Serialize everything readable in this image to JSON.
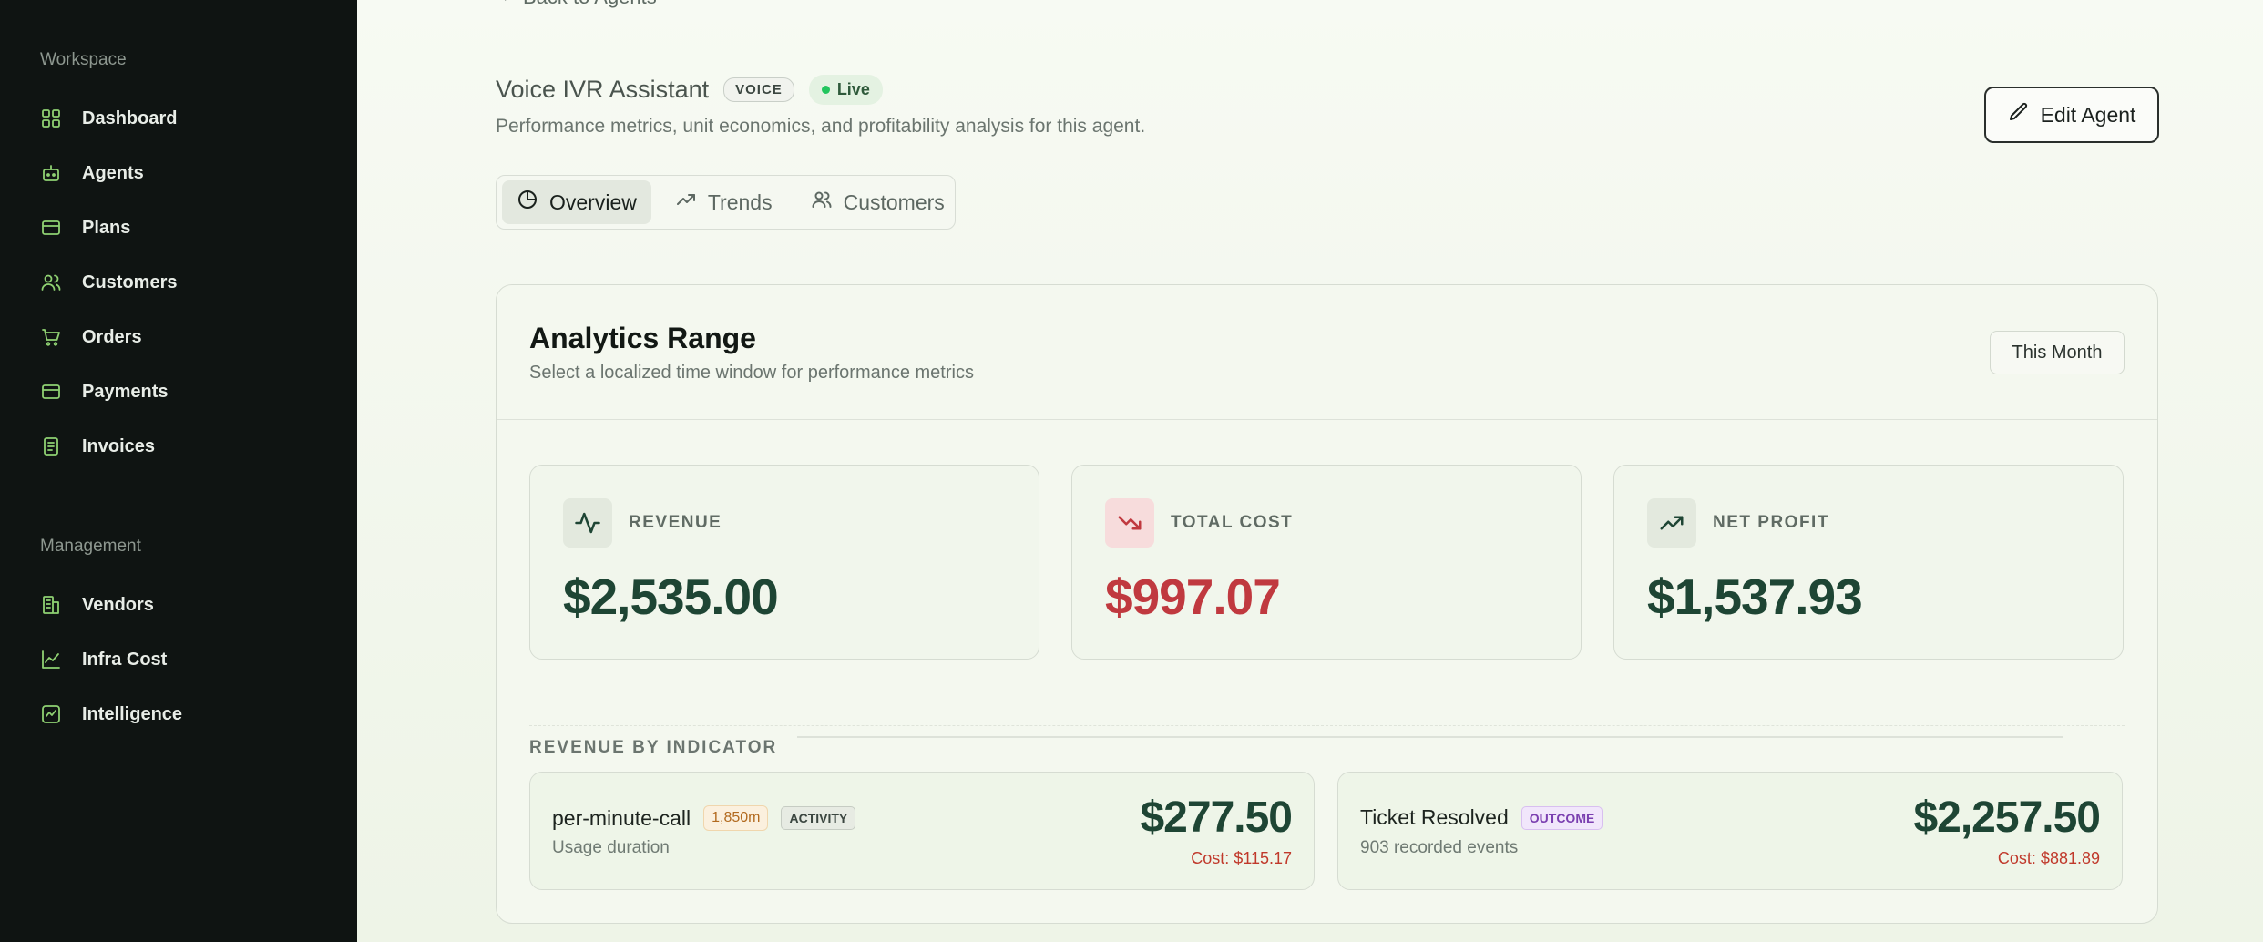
{
  "sidebar": {
    "workspace_label": "Workspace",
    "management_label": "Management",
    "workspace_items": [
      {
        "label": "Dashboard",
        "icon": "grid-icon"
      },
      {
        "label": "Agents",
        "icon": "bot-icon"
      },
      {
        "label": "Plans",
        "icon": "card-icon"
      },
      {
        "label": "Customers",
        "icon": "users-icon"
      },
      {
        "label": "Orders",
        "icon": "cart-icon"
      },
      {
        "label": "Payments",
        "icon": "card-icon"
      },
      {
        "label": "Invoices",
        "icon": "invoice-icon"
      }
    ],
    "management_items": [
      {
        "label": "Vendors",
        "icon": "building-icon"
      },
      {
        "label": "Infra Cost",
        "icon": "line-chart-icon"
      },
      {
        "label": "Intelligence",
        "icon": "activity-square-icon"
      }
    ]
  },
  "header": {
    "back_label": "Back to Agents",
    "agent_name": "Voice IVR Assistant",
    "type_badge": "VOICE",
    "status": "Live",
    "description": "Performance metrics, unit economics, and profitability analysis for this agent.",
    "edit_label": "Edit Agent"
  },
  "tabs": [
    {
      "label": "Overview",
      "active": true
    },
    {
      "label": "Trends",
      "active": false
    },
    {
      "label": "Customers",
      "active": false
    }
  ],
  "analytics": {
    "title": "Analytics Range",
    "subtitle": "Select a localized time window for performance metrics",
    "range": "This Month"
  },
  "metrics": {
    "revenue": {
      "label": "REVENUE",
      "value": "$2,535.00",
      "color": "#1e4534"
    },
    "cost": {
      "label": "TOTAL COST",
      "value": "$997.07",
      "color": "#c0393f"
    },
    "profit": {
      "label": "NET PROFIT",
      "value": "$1,537.93",
      "color": "#1e4534"
    }
  },
  "indicators": {
    "title": "REVENUE BY INDICATOR",
    "items": [
      {
        "name": "per-minute-call",
        "quantity": "1,850m",
        "kind": "ACTIVITY",
        "detail": "Usage duration",
        "amount": "$277.50",
        "cost": "Cost: $115.17"
      },
      {
        "name": "Ticket Resolved",
        "kind": "OUTCOME",
        "detail": "903 recorded events",
        "amount": "$2,257.50",
        "cost": "Cost: $881.89"
      }
    ]
  }
}
